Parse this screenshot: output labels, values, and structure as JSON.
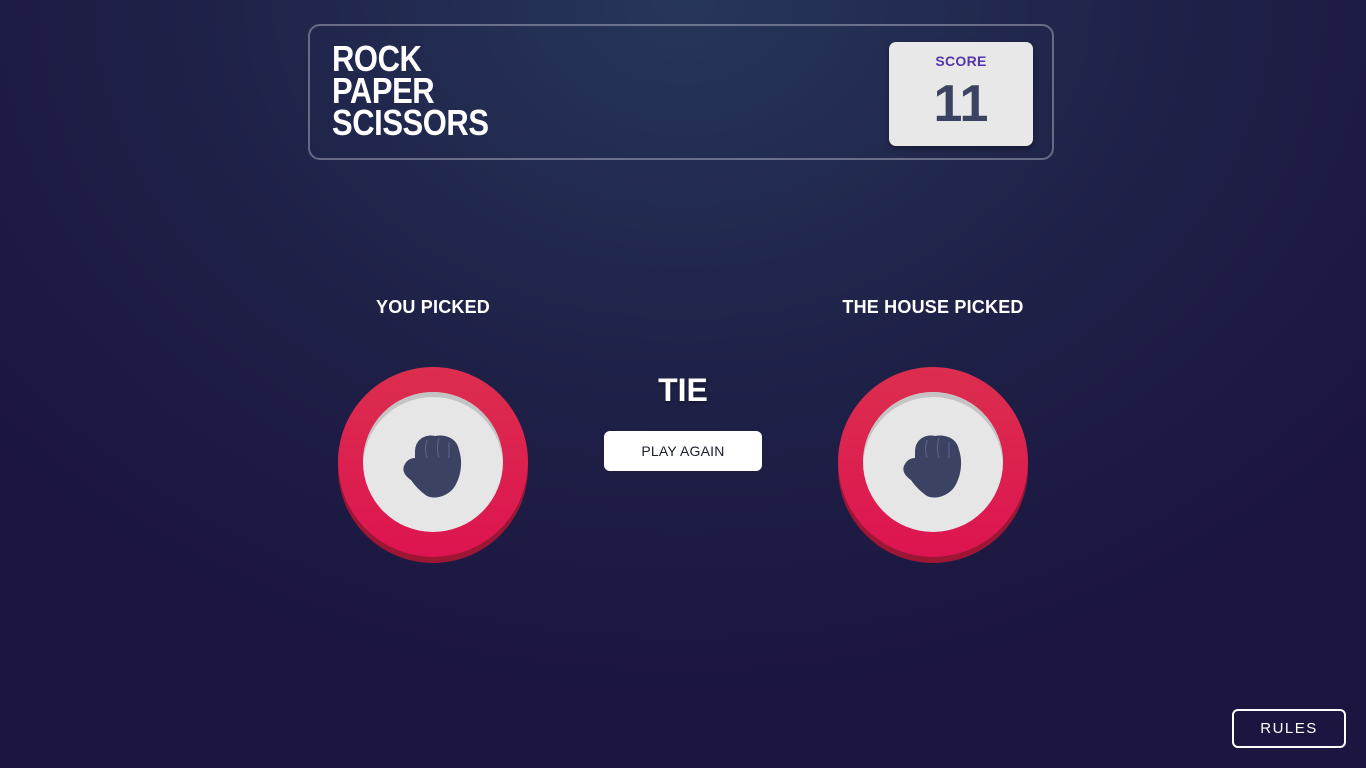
{
  "header": {
    "title_lines": [
      "ROCK",
      "PAPER",
      "SCISSORS"
    ],
    "score_label": "SCORE",
    "score_value": "11"
  },
  "game": {
    "you_label": "YOU PICKED",
    "house_label": "THE HOUSE PICKED",
    "you_pick": {
      "name": "rock",
      "icon": "rock-fist-icon",
      "ring_color": "#dc2e4e"
    },
    "house_pick": {
      "name": "rock",
      "icon": "rock-fist-icon",
      "ring_color": "#dc2e4e"
    },
    "result": "TIE",
    "play_again_label": "PLAY AGAIN"
  },
  "footer": {
    "rules_label": "RULES"
  },
  "colors": {
    "score_label": "#5436a8",
    "score_value": "#3b4262",
    "icon": "#3b4262"
  }
}
